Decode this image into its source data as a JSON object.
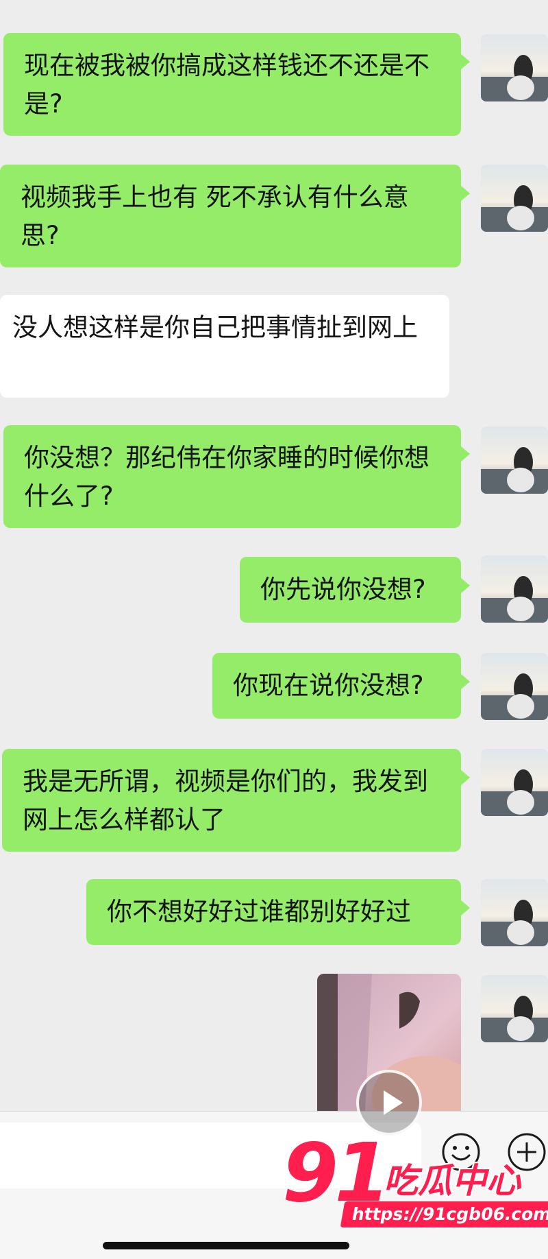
{
  "messages": [
    {
      "side": "me",
      "text": "现在被我被你搞成这样钱还不还是不是?"
    },
    {
      "side": "me",
      "text": "视频我手上也有 死不承认有什么意思?"
    },
    {
      "side": "them",
      "text": "没人想这样是你自己把事情扯到网上"
    },
    {
      "side": "me",
      "text": "你没想？那纪伟在你家睡的时候你想什么了?"
    },
    {
      "side": "me",
      "text": "你先说你没想?"
    },
    {
      "side": "me",
      "text": "你现在说你没想?"
    },
    {
      "side": "me",
      "text": "我是无所谓，视频是你们的，我发到网上怎么样都认了"
    },
    {
      "side": "me",
      "text": "你不想好好过谁都别好好过"
    }
  ],
  "video_message": {
    "icon": "play-icon"
  },
  "input_bar": {
    "emoji_icon": "emoji-icon",
    "add_icon": "plus-icon"
  },
  "watermark": {
    "number": "91",
    "brand": "吃瓜中心",
    "url": "https://91cgb06.com"
  },
  "colors": {
    "bubble_me": "#95ec69",
    "bubble_them": "#ffffff",
    "background": "#ededed",
    "watermark": "#ff1f4f"
  }
}
